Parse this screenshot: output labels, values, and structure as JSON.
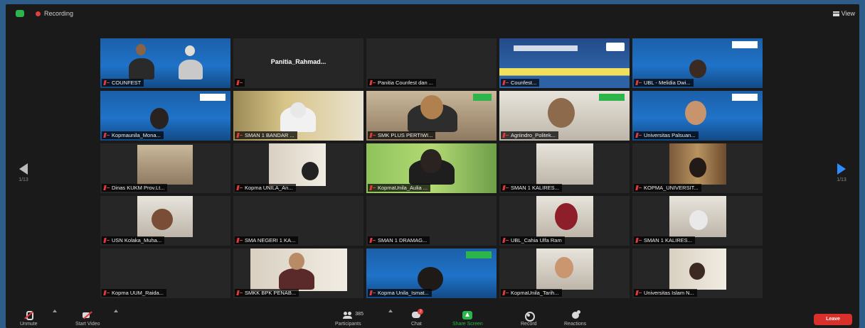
{
  "topbar": {
    "recording_label": "Recording",
    "view_label": "View"
  },
  "nav": {
    "prev_page": "1/13",
    "next_page": "1/13"
  },
  "tiles": [
    {
      "name": "COUNFEST",
      "center": ""
    },
    {
      "name": "",
      "center": "Panitia_Rahmad..."
    },
    {
      "name": "Panitia Counfest dan ...",
      "center": ""
    },
    {
      "name": "Counfest...",
      "center": ""
    },
    {
      "name": "UBL - Melidia Dwi...",
      "center": ""
    },
    {
      "name": "Kopmaunila_Mona...",
      "center": ""
    },
    {
      "name": "SMAN 1 BANDAR ...",
      "center": ""
    },
    {
      "name": "SMK PLUS PERTIWI...",
      "center": ""
    },
    {
      "name": "Agriindro_Politek...",
      "center": ""
    },
    {
      "name": "Universitas Palsuan...",
      "center": ""
    },
    {
      "name": "Dinas KUKM Prov.Lt...",
      "center": ""
    },
    {
      "name": "Kopma UNILA_An...",
      "center": ""
    },
    {
      "name": "KopmaUnila_Aulia ...",
      "center": ""
    },
    {
      "name": "SMAN 1 KALIRES...",
      "center": ""
    },
    {
      "name": "KOPMA_UNIVERSIT...",
      "center": ""
    },
    {
      "name": "USN Kolaka_Muha...",
      "center": ""
    },
    {
      "name": "SMA NEGERI 1 KA...",
      "center": ""
    },
    {
      "name": "SMAN 1 DRAMAG...",
      "center": ""
    },
    {
      "name": "UBL_Cahia Ulfa Ram",
      "center": ""
    },
    {
      "name": "SMAN 1 KALIRES...",
      "center": ""
    },
    {
      "name": "Kopma UUM_Raida...",
      "center": ""
    },
    {
      "name": "SMKK BPK PENAB...",
      "center": ""
    },
    {
      "name": "Kopma Unila_Ismat...",
      "center": ""
    },
    {
      "name": "KopmaUnila_Tarih...",
      "center": ""
    },
    {
      "name": "Universitas Islam N...",
      "center": ""
    }
  ],
  "toolbar": {
    "unmute": "Unmute",
    "start_video": "Start Video",
    "participants": "Participants",
    "participant_count": "385",
    "chat": "Chat",
    "chat_badge": "2",
    "share_screen": "Share Screen",
    "record": "Record",
    "reactions": "Reactions",
    "leave": "Leave"
  },
  "colors": {
    "accent_blue": "#2d8cff",
    "share_green": "#2bb54a",
    "leave_red": "#d9302c"
  }
}
